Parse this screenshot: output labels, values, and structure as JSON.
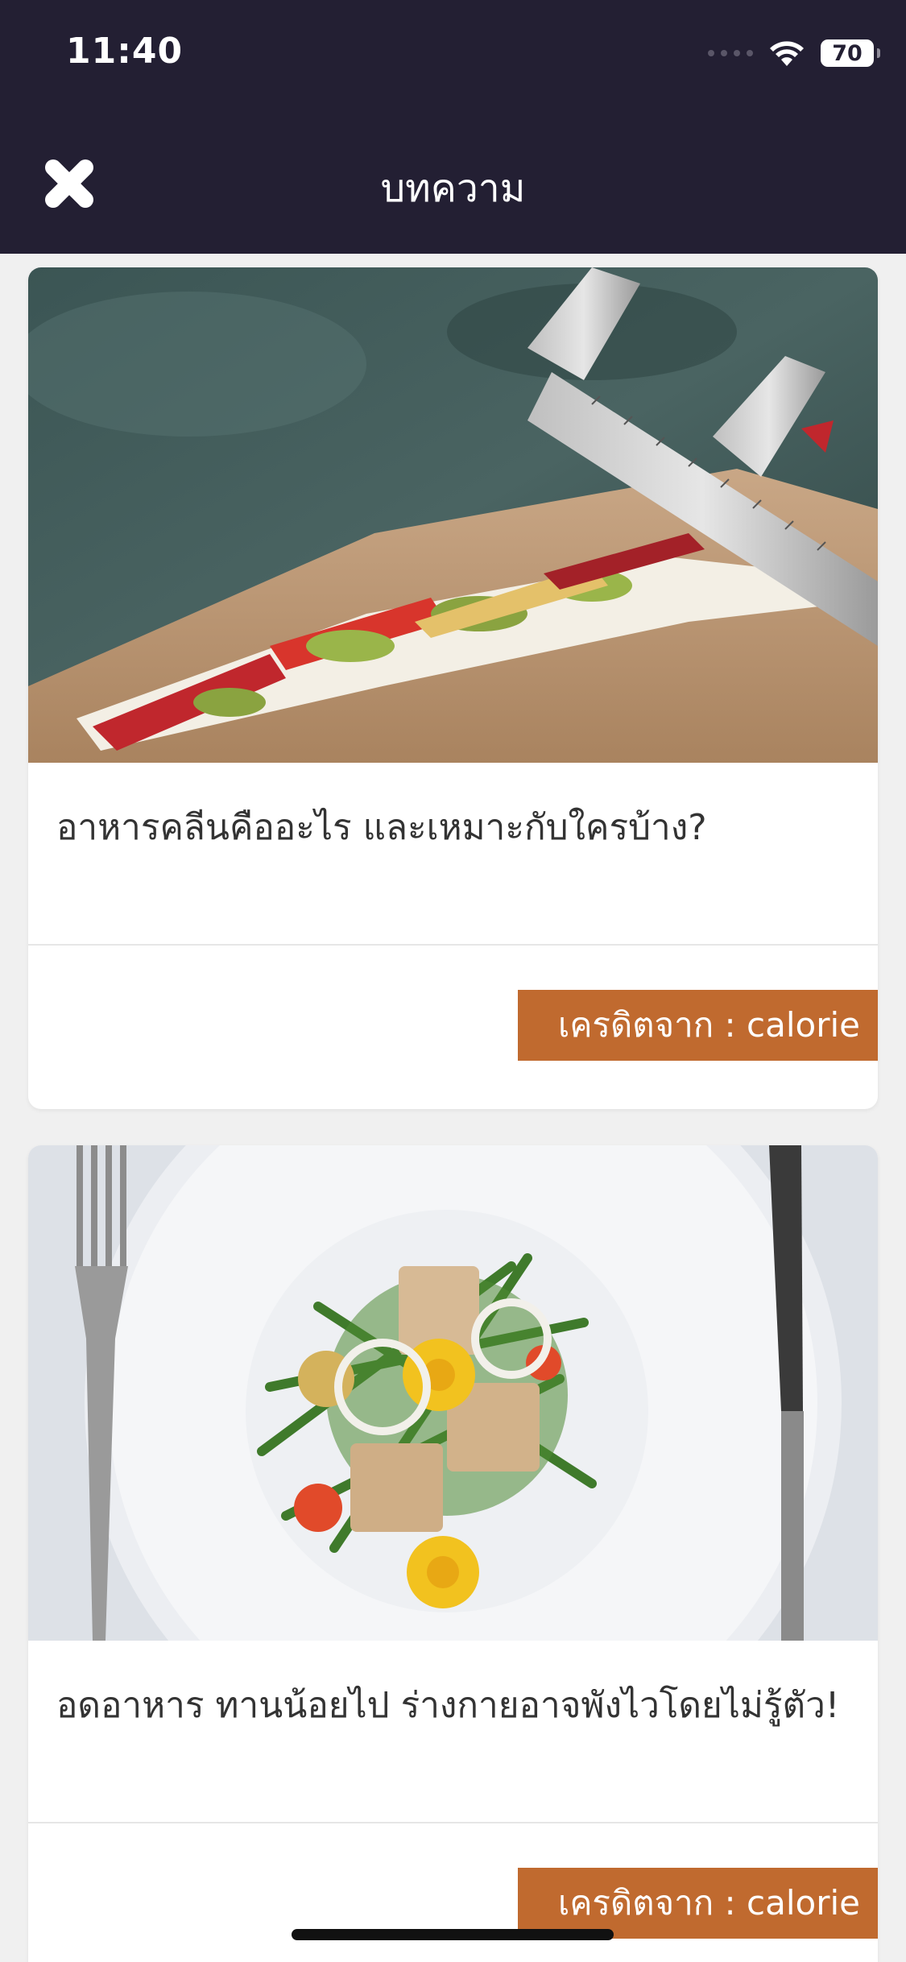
{
  "status_bar": {
    "time": "11:40",
    "battery": "70"
  },
  "header": {
    "title": "บทความ",
    "close_icon": "close-x-icon"
  },
  "articles": [
    {
      "title": "อาหารคลีนคืออะไร และเหมาะกับใครบ้าง?",
      "credit": "เครดิตจาก : calorie",
      "image": "sandwich-measured-with-caliper"
    },
    {
      "title": "อดอาหาร ทานน้อยไป ร่างกายอาจพังไวโดยไม่รู้ตัว!",
      "credit": "เครดิตจาก : calorie",
      "image": "salad-plate-with-fork-and-knife"
    }
  ],
  "colors": {
    "header_bg": "#231f33",
    "credit_badge": "#c06a2f",
    "page_bg": "#f0f0f0"
  }
}
